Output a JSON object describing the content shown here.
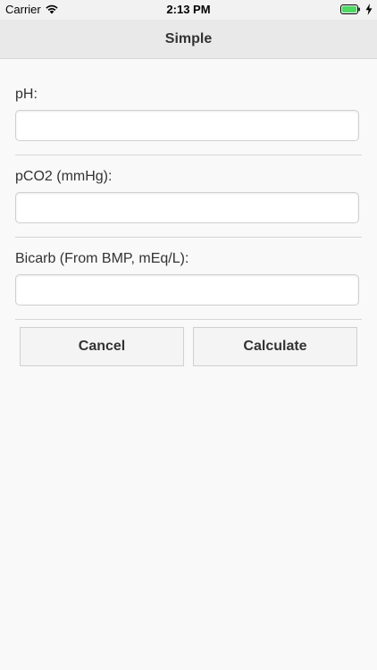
{
  "status_bar": {
    "carrier": "Carrier",
    "time": "2:13 PM",
    "battery_color": "#4cd964"
  },
  "header": {
    "title": "Simple"
  },
  "form": {
    "fields": [
      {
        "label": "pH:",
        "value": "",
        "placeholder": ""
      },
      {
        "label": "pCO2 (mmHg):",
        "value": "",
        "placeholder": ""
      },
      {
        "label": "Bicarb (From BMP, mEq/L):",
        "value": "",
        "placeholder": ""
      }
    ],
    "buttons": {
      "cancel_label": "Cancel",
      "calculate_label": "Calculate"
    }
  }
}
